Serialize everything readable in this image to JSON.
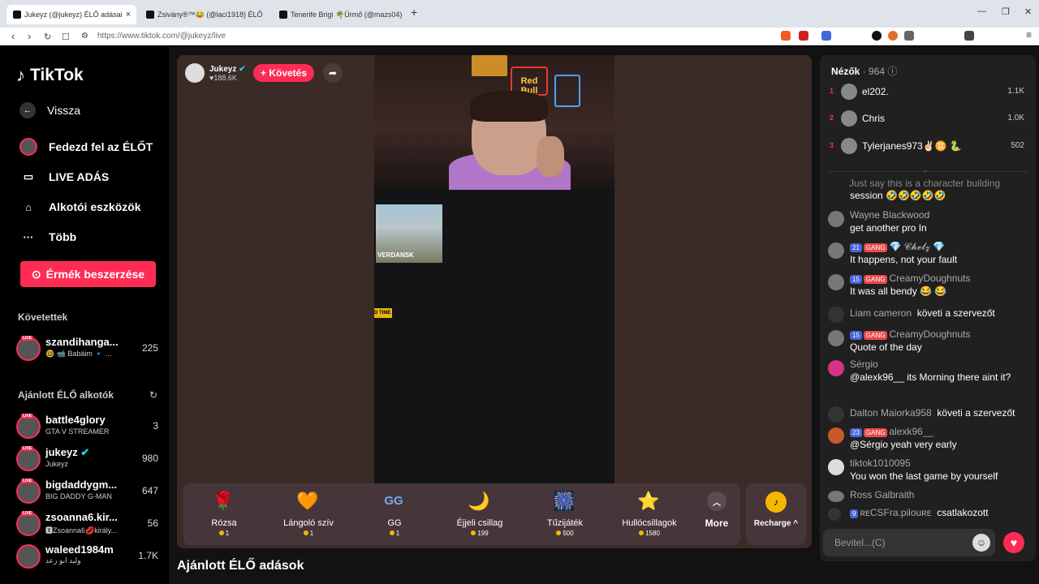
{
  "browser": {
    "tabs": [
      {
        "title": "Jukeyz (@jukeyz) ÉLŐ adásai"
      },
      {
        "title": "Zsivány®™😂 (@laci1918) ÉLŐ"
      },
      {
        "title": "Tenerife Brigi 🌴Ürmő (@mazs04) ÉL"
      }
    ],
    "new_tab": "+",
    "url": "https://www.tiktok.com/@jukeyz/live"
  },
  "sidebar": {
    "logo": "TikTok",
    "back": "Vissza",
    "nav": [
      {
        "label": "Fedezd fel az ÉLŐT"
      },
      {
        "label": "LIVE ADÁS"
      },
      {
        "label": "Alkotói eszközök"
      },
      {
        "label": "Több"
      }
    ],
    "coins_button": "Érmék beszerzése",
    "following_title": "Követettek",
    "following": [
      {
        "name": "szandihanga...",
        "sub": "🤓 📹 Babáim 🔹 ...",
        "count": "225"
      }
    ],
    "recommended_title": "Ajánlott ÉLŐ alkotók",
    "recommended": [
      {
        "name": "battle4glory",
        "sub": "GTA V STREAMER",
        "count": "3"
      },
      {
        "name": "jukeyz",
        "sub": "Jukeyz",
        "count": "980"
      },
      {
        "name": "bigdaddygm...",
        "sub": "BIG DADDY G-MAN",
        "count": "647"
      },
      {
        "name": "zsoanna6.kir...",
        "sub": "🆇Zsoanna6💋király...",
        "count": "56"
      },
      {
        "name": "waleed1984m",
        "sub": "وليد ابو رعد",
        "count": "1.7K"
      }
    ],
    "live_badge": "LIVE"
  },
  "stream": {
    "streamer_name": "Jukeyz",
    "likes": "188.6K",
    "follow_label": "+ Követés",
    "map_label": "VERDANSK",
    "hud_label": "D TIME",
    "neon_text": "Red Bull"
  },
  "gifts": [
    {
      "name": "Rózsa",
      "price": "1",
      "icon": "🌹"
    },
    {
      "name": "Lángoló szív",
      "price": "1",
      "icon": "🧡"
    },
    {
      "name": "GG",
      "price": "1",
      "icon": "GG"
    },
    {
      "name": "Éjjeli csillag",
      "price": "199",
      "icon": "🌙"
    },
    {
      "name": "Tűzijáték",
      "price": "500",
      "icon": "🎆"
    },
    {
      "name": "Hullócsillagok",
      "price": "1580",
      "icon": "⭐"
    }
  ],
  "more_label": "More",
  "recharge_label": "Recharge ^",
  "recommended_live_title": "Ajánlott ÉLŐ adások",
  "chat": {
    "viewers_label": "Nézők",
    "viewers_count": "· 964",
    "top": [
      {
        "rank": "1",
        "name": "el202.",
        "score": "1.1K"
      },
      {
        "rank": "2",
        "name": "Chris",
        "score": "1.0K"
      },
      {
        "rank": "3",
        "name": "Tylerjanes973✌🏻♊ 🐍",
        "score": "502"
      }
    ],
    "messages": [
      {
        "user": "Just say this is a character building",
        "text": "session 🤣🤣🤣🤣🤣"
      },
      {
        "user": "Wayne Blackwood",
        "text": "get another pro In"
      },
      {
        "user": "💎 𝓒𝓱𝓮𝓵𝔃 💎",
        "text": "It happens, not your fault",
        "level": "21",
        "gang": "GANG"
      },
      {
        "user": "CreamyDoughnuts",
        "text": "It was all bendy 😂 😂",
        "level": "15",
        "gang": "GANG"
      },
      {
        "user": "Liam cameron",
        "text": "követi a szervezőt"
      },
      {
        "user": "CreamyDoughnuts",
        "text": "Quote of the day",
        "level": "15",
        "gang": "GANG"
      },
      {
        "user": "Sérgio",
        "text": "@alexk96__ its Morning there aint it?"
      },
      {
        "user": "Dalton Maiorka958",
        "text": "követi a szervezőt"
      },
      {
        "user": "alexk96__",
        "text": "@Sérgio yeah very early",
        "level": "23",
        "gang": "GANG"
      },
      {
        "user": "tiktok1010095",
        "text": "You won the last game by yourself"
      },
      {
        "user": "Ross Galbraith",
        "text": ""
      },
      {
        "user": "ʀᴇCSFra.pilouʀᴇ",
        "text": "csatlakozott",
        "level": "9"
      }
    ],
    "input_placeholder": "Bevitel...(C)"
  }
}
